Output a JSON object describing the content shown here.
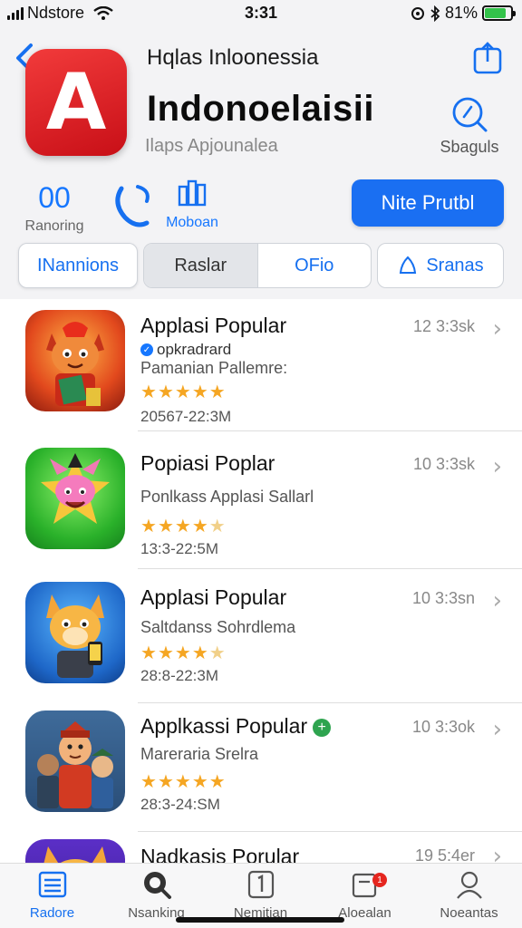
{
  "status_bar": {
    "carrier": "Ndstore",
    "time": "3:31",
    "battery": "81%",
    "battery_level": 0.81
  },
  "header": {
    "subtitle": "Hqlas Inloonessia",
    "title": "Indonoelaisii",
    "developer": "Ilaps Apjounalea",
    "app_icon_letter": "A",
    "search_label": "Sbaguls",
    "accent_color": "#1a6ff2",
    "icon_color": "#e0232b"
  },
  "stats": {
    "rating_value": "00",
    "rating_label": "Ranoring",
    "mobile_label": "Moboan"
  },
  "primary_button": {
    "label": "Nite Prutbl"
  },
  "segments": {
    "first": "INannions",
    "group": [
      "Raslar",
      "OFio"
    ],
    "last": "Sranas"
  },
  "apps": [
    {
      "title": "Applasi Popular",
      "line2": "opkradrard",
      "line3": "Pamanian Pallemre:",
      "rating": 5,
      "date": "20567-22:3M",
      "time": "12 3:3sk",
      "verified": true
    },
    {
      "title": "Popiasi Poplar",
      "line2": "Ponlkass Applasi Sallarl",
      "line3": "",
      "rating": 4.5,
      "date": "13:3-22:5M",
      "time": "10 3:3sk",
      "verified": false
    },
    {
      "title": "Applasi Popular",
      "line2": "Saltdanss Sohrdlema",
      "line3": "",
      "rating": 4.5,
      "date": "28:8-22:3M",
      "time": "10 3:3sn",
      "verified": false
    },
    {
      "title": "Applkassi Popular",
      "line2": "Mareraria Srelra",
      "line3": "",
      "rating": 5,
      "date": "28:3-24:SM",
      "time": "10 3:3ok",
      "verified": false,
      "plus_badge": true
    },
    {
      "title": "Nadkasis Porular",
      "line2": "",
      "line3": "",
      "rating": 0,
      "date": "",
      "time": "19 5:4er",
      "verified": false
    }
  ],
  "tabbar": [
    {
      "label": "Radore",
      "icon": "list-icon",
      "active": true
    },
    {
      "label": "Nsanking",
      "icon": "search-icon",
      "active": false
    },
    {
      "label": "Nemitian",
      "icon": "number-1-icon",
      "active": false
    },
    {
      "label": "Aloealan",
      "icon": "updates-icon",
      "badge": "1",
      "active": false
    },
    {
      "label": "Noeantas",
      "icon": "person-icon",
      "active": false
    }
  ]
}
